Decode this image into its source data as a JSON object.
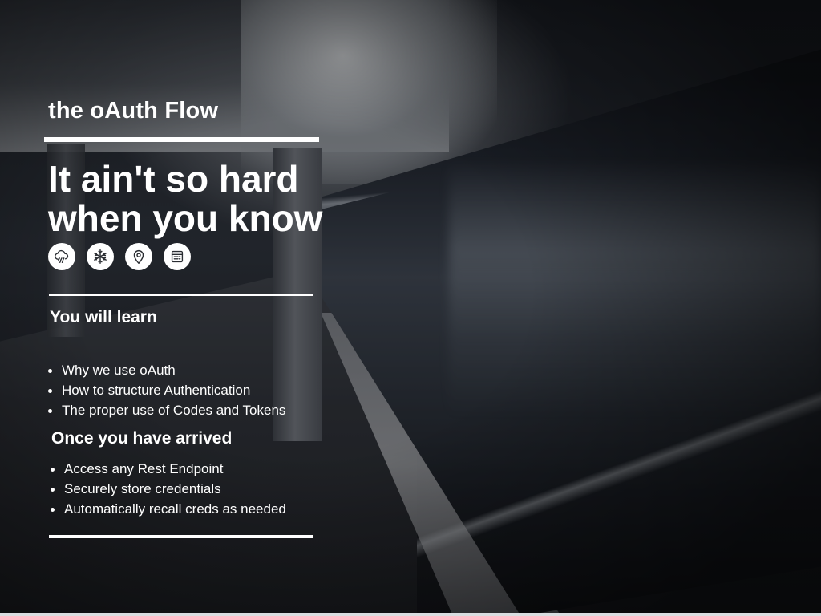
{
  "slide": {
    "title": "the oAuth Flow",
    "headline_line1": "It ain't so hard",
    "headline_line2": "when you know",
    "icons": [
      "cloud-rain-icon",
      "snowflake-icon",
      "map-pin-icon",
      "calendar-icon"
    ],
    "learn": {
      "heading": "You will learn",
      "items": [
        "Why we use oAuth",
        "How to structure Authentication",
        "The proper use of Codes and Tokens"
      ]
    },
    "arrived": {
      "heading": "Once you have arrived",
      "items": [
        "Access any Rest Endpoint",
        "Securely store credentials",
        "Automatically recall creds as needed"
      ]
    }
  },
  "colors": {
    "text": "#ffffff",
    "icon_fill": "#ffffff",
    "icon_stroke": "#2a2d32"
  }
}
